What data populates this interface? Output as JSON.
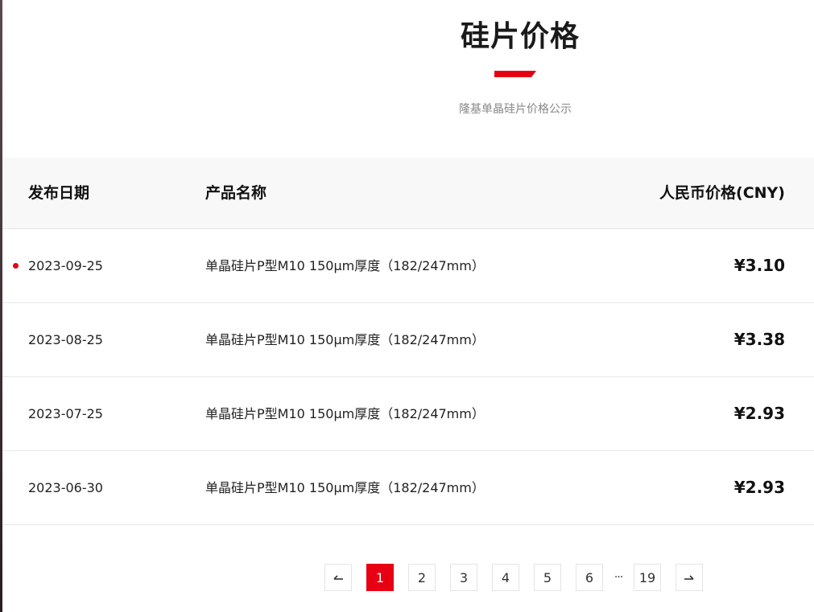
{
  "header": {
    "title": "硅片价格",
    "subtitle": "隆基单晶硅片价格公示"
  },
  "colors": {
    "accent": "#e60012",
    "header_bg": "#f8f8f8"
  },
  "table": {
    "columns": {
      "date": "发布日期",
      "name": "产品名称",
      "price": "人民币价格(CNY)"
    },
    "rows": [
      {
        "date": "2023-09-25",
        "name": "单晶硅片P型M10 150μm厚度（182/247mm）",
        "price": "¥3.10",
        "latest": true
      },
      {
        "date": "2023-08-25",
        "name": "单晶硅片P型M10 150μm厚度（182/247mm）",
        "price": "¥3.38",
        "latest": false
      },
      {
        "date": "2023-07-25",
        "name": "单晶硅片P型M10 150μm厚度（182/247mm）",
        "price": "¥2.93",
        "latest": false
      },
      {
        "date": "2023-06-30",
        "name": "单晶硅片P型M10 150μm厚度（182/247mm）",
        "price": "¥2.93",
        "latest": false
      }
    ]
  },
  "pagination": {
    "prev_icon": "arrow-left-icon",
    "next_icon": "arrow-right-icon",
    "current_page": 1,
    "pages": [
      "1",
      "2",
      "3",
      "4",
      "5",
      "6"
    ],
    "ellipsis": "···",
    "last_page": "19"
  }
}
